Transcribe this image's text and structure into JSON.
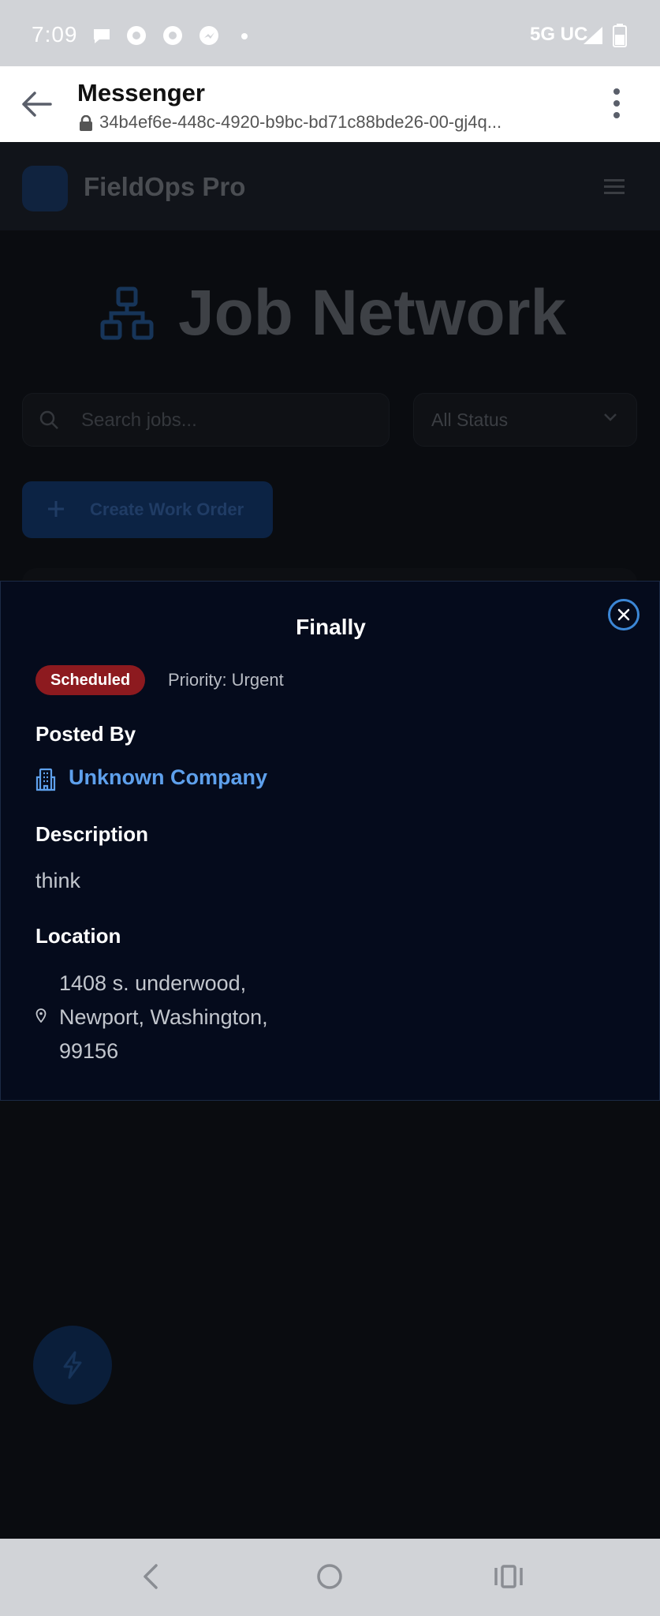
{
  "status_bar": {
    "time": "7:09",
    "network": "5G UC",
    "icons": [
      "chat-bubble-icon",
      "app-icon",
      "app-icon",
      "messenger-icon",
      "signal-icon",
      "battery-icon"
    ]
  },
  "browser": {
    "title": "Messenger",
    "url": "34b4ef6e-448c-4920-b9bc-bd71c88bde26-00-gj4q..."
  },
  "app": {
    "name": "FieldOps Pro",
    "page_title": "Job Network",
    "search_placeholder": "Search jobs...",
    "status_filter": "All Status",
    "create_button": "Create Work Order"
  },
  "modal": {
    "title": "Finally",
    "status_badge": "Scheduled",
    "priority": "Priority: Urgent",
    "posted_by_heading": "Posted By",
    "company": "Unknown Company",
    "description_heading": "Description",
    "description": "think",
    "location_heading": "Location",
    "address_line1": "1408 s. underwood,",
    "address_line2": "Newport, Washington,",
    "address_line3": "99156"
  },
  "colors": {
    "accent": "#5ea0ec",
    "badge_scheduled": "#8d1a1f",
    "modal_bg": "#050b1c",
    "close_ring": "#3c87d6"
  }
}
